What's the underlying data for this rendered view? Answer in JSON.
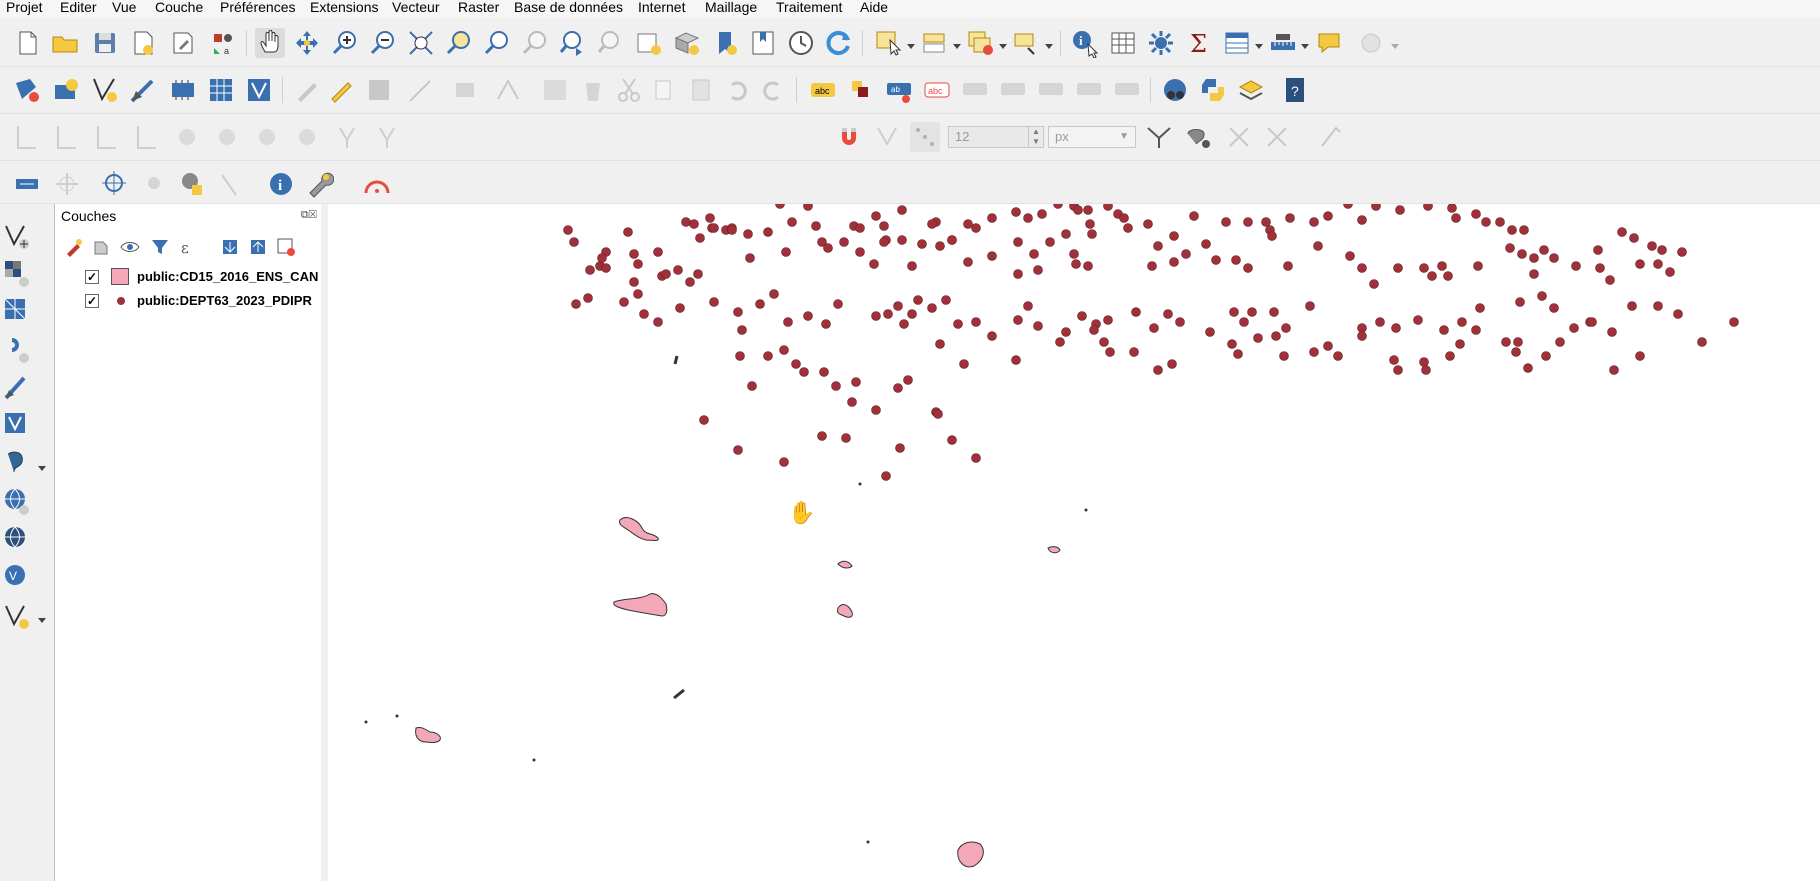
{
  "menu": [
    "Projet",
    "Editer",
    "Vue",
    "Couche",
    "Préférences",
    "Extensions",
    "Vecteur",
    "Raster",
    "Base de données",
    "Internet",
    "Maillage",
    "Traitement",
    "Aide"
  ],
  "toolbar_snapping": {
    "tolerance": "12",
    "unit": "px"
  },
  "layers_panel": {
    "title": "Couches",
    "layers": [
      {
        "name": "public:CD15_2016_ENS_CAN",
        "checked": "✓",
        "symbol": "polygon",
        "color": "#f4a7b9"
      },
      {
        "name": "public:DEPT63_2023_PDIPR",
        "checked": "✓",
        "symbol": "point",
        "color": "#a0303a"
      }
    ]
  },
  "colors": {
    "point": "#a0303a",
    "polygon_fill": "#f4a7b9",
    "polygon_stroke": "#333333"
  },
  "icons": {
    "toolbar1": [
      "new-project-icon",
      "open-project-icon",
      "save-project-icon",
      "save-as-icon",
      "print-layout-icon",
      "style-manager-icon",
      "pan-icon",
      "pan-to-selection-icon",
      "zoom-in-icon",
      "zoom-out-icon",
      "zoom-full-icon",
      "zoom-to-selection-icon",
      "zoom-to-layer-icon",
      "zoom-native-icon",
      "zoom-last-icon",
      "zoom-next-icon",
      "new-map-view-icon",
      "new-3d-view-icon",
      "bookmark-icon",
      "show-bookmarks-icon",
      "temporal-controller-icon",
      "refresh-icon",
      "select-features-icon",
      "select-by-value-icon",
      "deselect-icon",
      "select-by-location-icon",
      "identify-icon",
      "attribute-table-icon",
      "processing-toolbox-icon",
      "statistics-icon",
      "open-attribute-table-icon",
      "measure-icon",
      "annotation-icon",
      "plugin-icon"
    ],
    "leftbar": [
      "add-vector-layer-icon",
      "add-raster-layer-icon",
      "add-mesh-layer-icon",
      "add-delimited-text-icon",
      "add-spatialite-icon",
      "add-virtual-layer-icon",
      "add-postgis-icon",
      "add-wms-icon",
      "add-wfs-icon",
      "add-wcs-icon",
      "new-shapefile-icon"
    ]
  }
}
